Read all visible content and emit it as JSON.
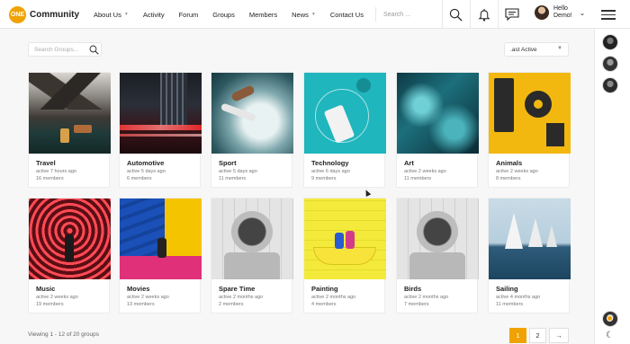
{
  "header": {
    "logo_mark": "ONE",
    "logo_text": "Community",
    "nav": [
      {
        "label": "About Us",
        "dropdown": true
      },
      {
        "label": "Activity",
        "dropdown": false
      },
      {
        "label": "Forum",
        "dropdown": false
      },
      {
        "label": "Groups",
        "dropdown": false
      },
      {
        "label": "Members",
        "dropdown": false
      },
      {
        "label": "News",
        "dropdown": true
      },
      {
        "label": "Contact Us",
        "dropdown": false
      }
    ],
    "search_placeholder": "Search ...",
    "greeting_line1": "Hello",
    "greeting_line2": "Demo!",
    "icons": [
      "search-icon",
      "bell-icon",
      "message-icon",
      "chevron-down-icon",
      "menu-icon"
    ]
  },
  "toolbar": {
    "search_placeholder": "Search Groups...",
    "sort_value": ".ast Active"
  },
  "groups": [
    {
      "name": "Travel",
      "active": "active 7 hours ago",
      "members": "16 members"
    },
    {
      "name": "Automotive",
      "active": "active 5 days ago",
      "members": "6 members"
    },
    {
      "name": "Sport",
      "active": "active 5 days ago",
      "members": "11 members"
    },
    {
      "name": "Technology",
      "active": "active 6 days ago",
      "members": "9 members"
    },
    {
      "name": "Art",
      "active": "active 2 weeks ago",
      "members": "11 members"
    },
    {
      "name": "Animals",
      "active": "active 2 weeks ago",
      "members": "8 members"
    },
    {
      "name": "Music",
      "active": "active 2 weeks ago",
      "members": "19 members"
    },
    {
      "name": "Movies",
      "active": "active 2 weeks ago",
      "members": "13 members"
    },
    {
      "name": "Spare Time",
      "active": "active 2 months ago",
      "members": "2 members"
    },
    {
      "name": "Painting",
      "active": "active 2 months ago",
      "members": "4 members"
    },
    {
      "name": "Birds",
      "active": "active 2 months ago",
      "members": "7 members"
    },
    {
      "name": "Sailing",
      "active": "active 4 months ago",
      "members": "11 members"
    }
  ],
  "footer": {
    "viewing": "Viewing 1 - 12 of 20 groups",
    "pages": [
      "1",
      "2",
      "→"
    ],
    "current_page": "1"
  },
  "colors": {
    "accent": "#f0a202"
  }
}
